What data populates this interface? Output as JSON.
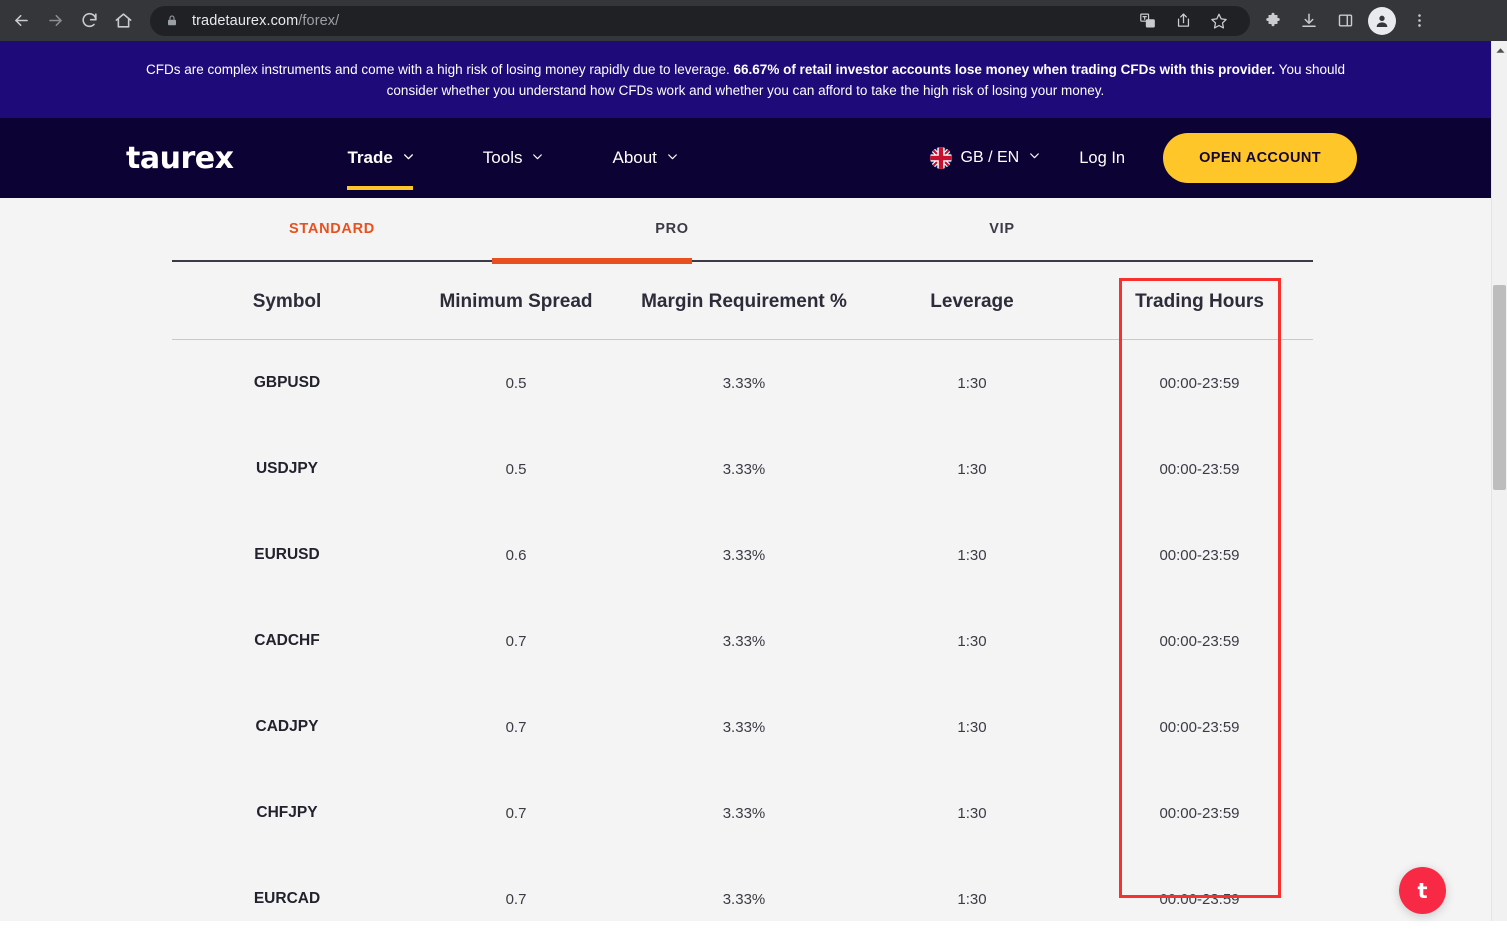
{
  "browser": {
    "back_icon": "back-arrow-icon",
    "forward_icon": "forward-arrow-icon",
    "reload_icon": "reload-icon",
    "home_icon": "home-icon",
    "lock_icon": "lock-icon",
    "url_domain": "tradetaurex.com",
    "url_path": "/forex/",
    "translate_icon": "translate-icon",
    "share_icon": "share-icon",
    "bookmark_icon": "bookmark-star-icon",
    "extensions_icon": "extensions-puzzle-icon",
    "downloads_icon": "download-icon",
    "sidepanel_icon": "side-panel-icon",
    "profile_icon": "profile-avatar-icon",
    "menu_icon": "three-dot-menu-icon"
  },
  "risk_banner": {
    "text_before": "CFDs are complex instruments and come with a high risk of losing money rapidly due to leverage. ",
    "text_bold": "66.67% of retail investor accounts lose money when trading CFDs with this provider.",
    "text_after": " You should consider whether you understand how CFDs work and whether you can afford to take the high risk of losing your money.",
    "background": "#1E0A79"
  },
  "site_nav": {
    "logo": "taurex",
    "background": "#0C0233",
    "accent": "#FFC629",
    "links": [
      {
        "label": "Trade",
        "active": true
      },
      {
        "label": "Tools",
        "active": false
      },
      {
        "label": "About",
        "active": false
      }
    ],
    "locale": "GB / EN",
    "flag_icon": "uk-flag-icon",
    "login_label": "Log In",
    "cta_label": "OPEN ACCOUNT"
  },
  "account_tabs": {
    "active_color": "#E8511F",
    "items": [
      {
        "label": "STANDARD",
        "active": true
      },
      {
        "label": "PRO",
        "active": false
      },
      {
        "label": "VIP",
        "active": false
      }
    ]
  },
  "rates_table": {
    "columns": [
      "Symbol",
      "Minimum Spread",
      "Margin Requirement %",
      "Leverage",
      "Trading Hours"
    ],
    "rows": [
      {
        "symbol": "GBPUSD",
        "spread": "0.5",
        "margin": "3.33%",
        "leverage": "1:30",
        "hours": "00:00-23:59"
      },
      {
        "symbol": "USDJPY",
        "spread": "0.5",
        "margin": "3.33%",
        "leverage": "1:30",
        "hours": "00:00-23:59"
      },
      {
        "symbol": "EURUSD",
        "spread": "0.6",
        "margin": "3.33%",
        "leverage": "1:30",
        "hours": "00:00-23:59"
      },
      {
        "symbol": "CADCHF",
        "spread": "0.7",
        "margin": "3.33%",
        "leverage": "1:30",
        "hours": "00:00-23:59"
      },
      {
        "symbol": "CADJPY",
        "spread": "0.7",
        "margin": "3.33%",
        "leverage": "1:30",
        "hours": "00:00-23:59"
      },
      {
        "symbol": "CHFJPY",
        "spread": "0.7",
        "margin": "3.33%",
        "leverage": "1:30",
        "hours": "00:00-23:59"
      },
      {
        "symbol": "EURCAD",
        "spread": "0.7",
        "margin": "3.33%",
        "leverage": "1:30",
        "hours": "00:00-23:59"
      }
    ]
  },
  "annotation": {
    "target_column": "Trading Hours",
    "color": "#F8312F"
  },
  "chat_widget": {
    "label": "t",
    "color": "#F72945"
  }
}
